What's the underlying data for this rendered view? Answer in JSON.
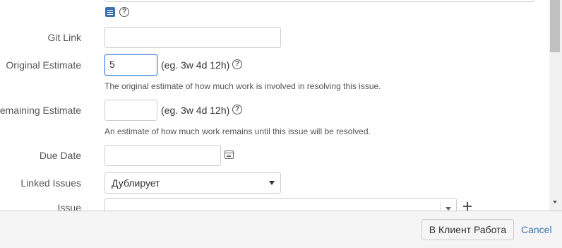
{
  "toolbar": {
    "wiki_icon": "wiki-markup-icon",
    "help_icon": "help-icon",
    "help_glyph": "?"
  },
  "fields": {
    "git_link": {
      "label": "Git Link",
      "value": ""
    },
    "original_estimate": {
      "label": "Original Estimate",
      "value": "5",
      "format_hint": "(eg. 3w 4d 12h)",
      "description": "The original estimate of how much work is involved in resolving this issue."
    },
    "remaining_estimate": {
      "label": "Remaining Estimate",
      "value": "",
      "format_hint": "(eg. 3w 4d 12h)",
      "description": "An estimate of how much work remains until this issue will be resolved."
    },
    "due_date": {
      "label": "Due Date",
      "value": "",
      "icon": "calendar-icon"
    },
    "linked_issues": {
      "label": "Linked Issues",
      "selected": "Дублирует"
    },
    "issue": {
      "label": "Issue",
      "value": "",
      "add_icon": "plus-icon"
    }
  },
  "footer": {
    "submit_label": "В Клиент Работа",
    "cancel_label": "Cancel"
  },
  "colors": {
    "link": "#3b73af",
    "focus_border": "#4a8be0",
    "footer_bg": "#f5f5f5"
  }
}
